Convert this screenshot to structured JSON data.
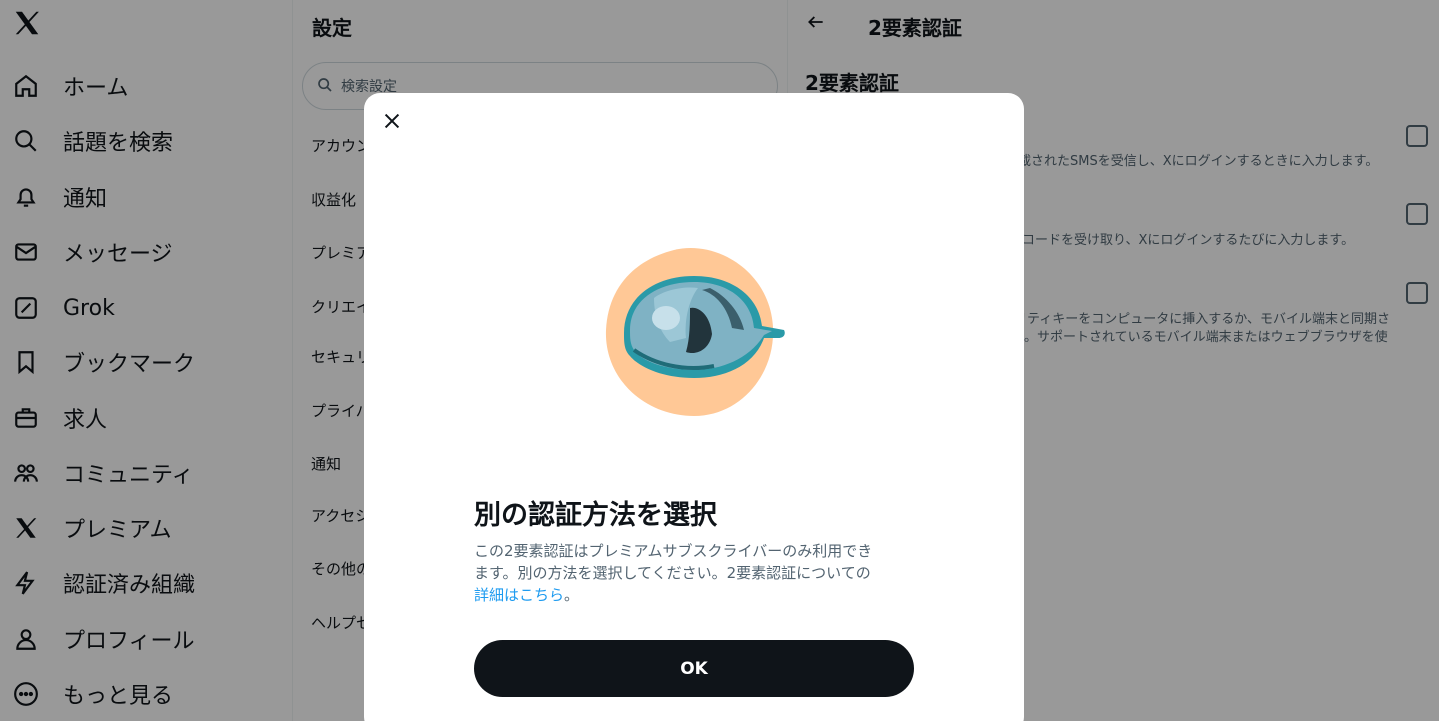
{
  "nav": {
    "logo": "𝕏",
    "items": [
      {
        "label": "ホーム",
        "icon": "home-icon"
      },
      {
        "label": "話題を検索",
        "icon": "search-icon"
      },
      {
        "label": "通知",
        "icon": "bell-icon"
      },
      {
        "label": "メッセージ",
        "icon": "mail-icon"
      },
      {
        "label": "Grok",
        "icon": "grok-icon"
      },
      {
        "label": "ブックマーク",
        "icon": "bookmark-icon"
      },
      {
        "label": "求人",
        "icon": "briefcase-icon"
      },
      {
        "label": "コミュニティ",
        "icon": "people-icon"
      },
      {
        "label": "プレミアム",
        "icon": "x-icon"
      },
      {
        "label": "認証済み組織",
        "icon": "lightning-icon"
      },
      {
        "label": "プロフィール",
        "icon": "person-icon"
      },
      {
        "label": "もっと見る",
        "icon": "more-icon"
      }
    ]
  },
  "settings": {
    "title": "設定",
    "search_placeholder": "検索設定",
    "items": [
      "アカウント",
      "収益化",
      "プレミアム",
      "クリエイター",
      "セキュリティ",
      "プライバシー",
      "通知",
      "アクセシビリティ",
      "その他の",
      "ヘルプセンター"
    ]
  },
  "detail": {
    "title": "2要素認証",
    "heading": "2要素認証",
    "options": [
      {
        "desc": "載されたSMSを受信し、Xにログインするときに入力します。"
      },
      {
        "desc": "コードを受け取り、Xにログインするたびに入力します。"
      },
      {
        "desc_line1": "リティキーをコンピュータに挿入するか、モバイル端末と同期さ",
        "desc_line2": "。サポートされているモバイル端末またはウェブブラウザを使"
      }
    ]
  },
  "modal": {
    "title": "別の認証方法を選択",
    "body_line1": "この2要素認証はプレミアムサブスクライバーのみ利用でき",
    "body_line2": "ます。別の方法を選択してください。2要素認証についての",
    "link": "詳細はこちら",
    "after_link": "。",
    "ok_label": "OK",
    "close_icon": "close-icon",
    "illustration": "hard-hat-illustration"
  },
  "colors": {
    "accent": "#1d9bf0",
    "text": "#0f1419",
    "muted": "#536471",
    "overlay": "rgba(0,0,0,0.4)",
    "ok_bg": "#0f1419"
  }
}
